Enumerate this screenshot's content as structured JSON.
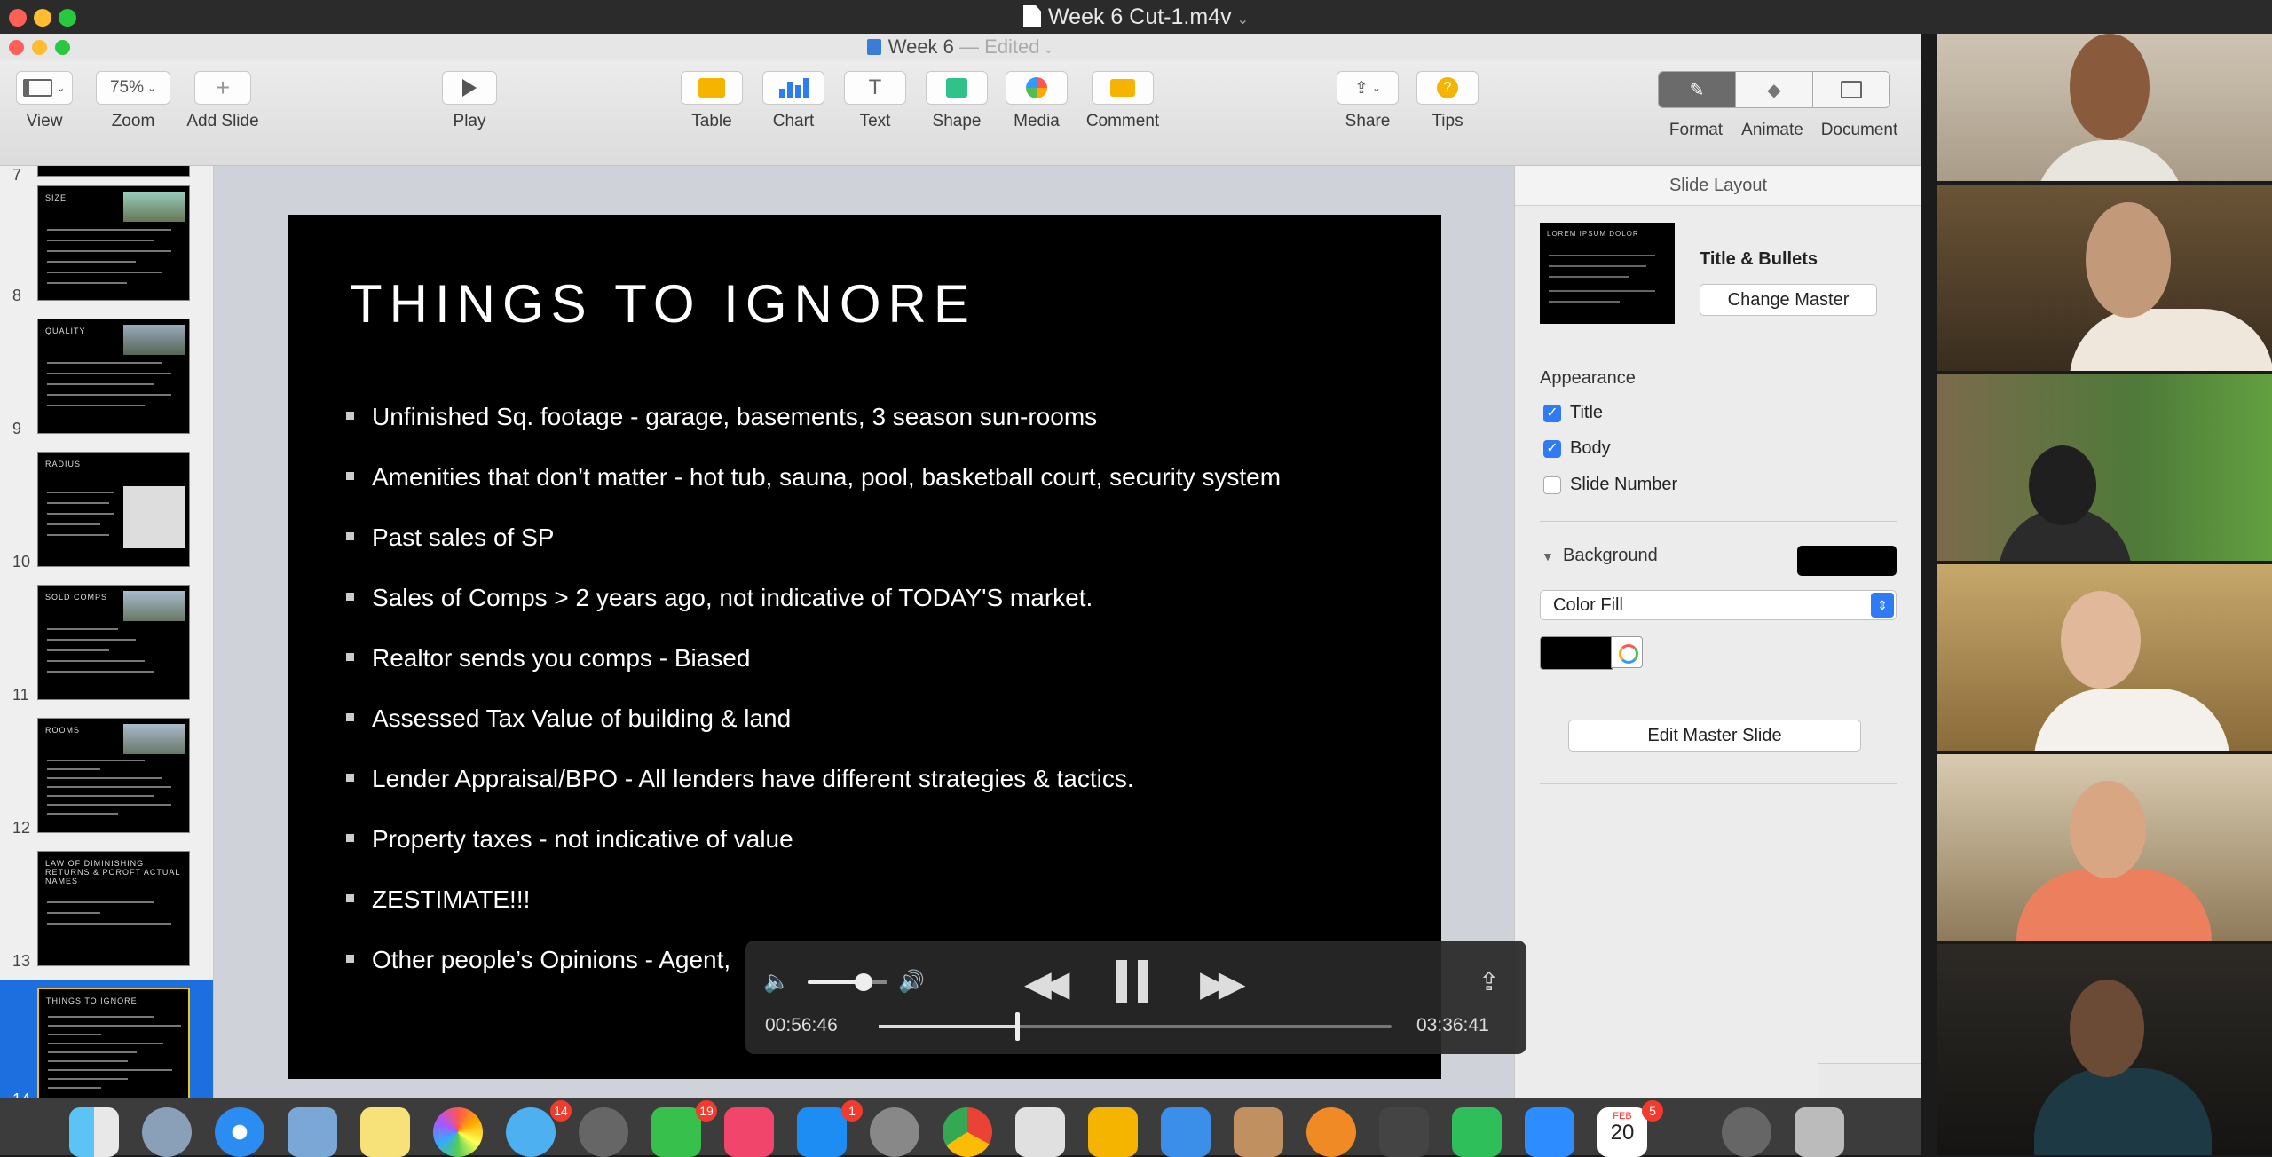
{
  "window": {
    "title": "Week 6 Cut-1.m4v"
  },
  "keynote": {
    "doc_title": "Week 6",
    "edited": "— Edited",
    "toolbar": {
      "view": "View",
      "zoom_value": "75%",
      "zoom": "Zoom",
      "add_slide": "Add Slide",
      "play": "Play",
      "table": "Table",
      "chart": "Chart",
      "text": "Text",
      "shape": "Shape",
      "media": "Media",
      "comment": "Comment",
      "share": "Share",
      "tips": "Tips",
      "format": "Format",
      "animate": "Animate",
      "document": "Document"
    },
    "navigator": {
      "slides": [
        {
          "num": "7",
          "title": ""
        },
        {
          "num": "8",
          "title": "SIZE"
        },
        {
          "num": "9",
          "title": "QUALITY"
        },
        {
          "num": "10",
          "title": "RADIUS"
        },
        {
          "num": "11",
          "title": "SOLD COMPS"
        },
        {
          "num": "12",
          "title": "ROOMS"
        },
        {
          "num": "13",
          "title": "LAW OF DIMINISHING RETURNS & POROFT ACTUAL NAMES"
        },
        {
          "num": "14",
          "title": "THINGS TO IGNORE"
        }
      ]
    },
    "slide": {
      "title": "THINGS TO IGNORE",
      "bullets": [
        "Unfinished Sq. footage - garage, basements, 3 season sun-rooms",
        "Amenities that don’t matter - hot tub, sauna, pool, basketball court, security system",
        "Past sales of SP",
        "Sales of Comps > 2 years ago, not indicative of TODAY'S market.",
        "Realtor sends you comps - Biased",
        "Assessed Tax Value of building & land",
        "Lender Appraisal/BPO - All lenders have different strategies & tactics.",
        "Property taxes - not indicative of value",
        "ZESTIMATE!!!",
        "Other people’s Opinions - Agent,"
      ]
    },
    "inspector": {
      "header": "Slide Layout",
      "layout_name": "Title & Bullets",
      "change_master": "Change Master",
      "thumb_title": "LOREM IPSUM DOLOR",
      "appearance": "Appearance",
      "title_chk": "Title",
      "body_chk": "Body",
      "slide_number_chk": "Slide Number",
      "background": "Background",
      "fill_type": "Color Fill",
      "edit_master": "Edit Master Slide",
      "bg_color": "#000000"
    }
  },
  "player": {
    "current_time": "00:56:46",
    "total_time": "03:36:41",
    "progress": 0.27,
    "volume": 0.7
  },
  "dock_badges": {
    "facetime": "14",
    "messages": "19",
    "appstore": "1",
    "calendar": "5",
    "calendar_date": "20",
    "calendar_month": "FEB"
  }
}
